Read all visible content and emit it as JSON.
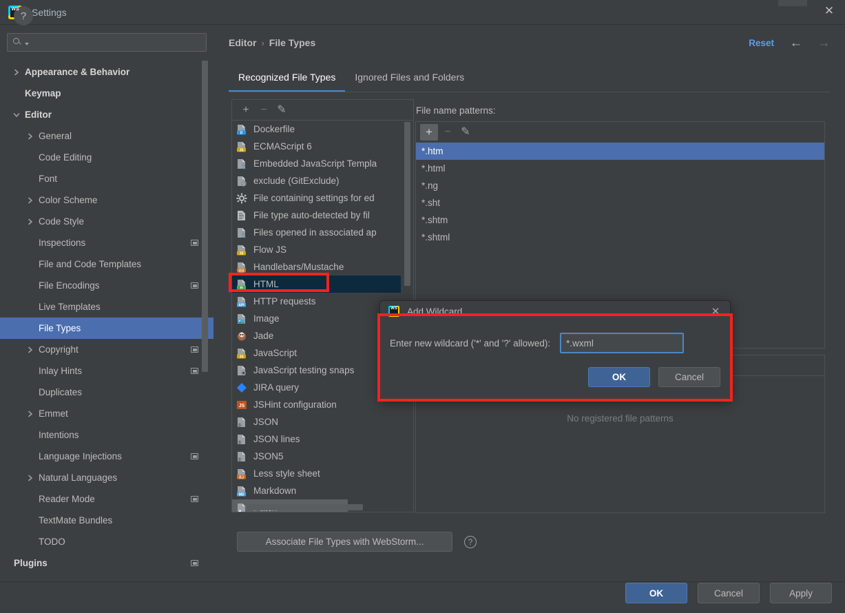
{
  "window": {
    "title": "Settings",
    "logo_text": "WS",
    "close_icon": "✕"
  },
  "sidebar": {
    "search": {
      "value": "",
      "placeholder": ""
    },
    "items": [
      {
        "label": "Appearance & Behavior",
        "arrow": "right",
        "indent": 20,
        "bold": true,
        "badge": false,
        "selected": false
      },
      {
        "label": "Keymap",
        "arrow": "none",
        "indent": 36,
        "bold": true,
        "badge": false,
        "selected": false
      },
      {
        "label": "Editor",
        "arrow": "down",
        "indent": 20,
        "bold": true,
        "badge": false,
        "selected": false
      },
      {
        "label": "General",
        "arrow": "right",
        "indent": 40,
        "bold": false,
        "badge": false,
        "selected": false
      },
      {
        "label": "Code Editing",
        "arrow": "none",
        "indent": 56,
        "bold": false,
        "badge": false,
        "selected": false
      },
      {
        "label": "Font",
        "arrow": "none",
        "indent": 56,
        "bold": false,
        "badge": false,
        "selected": false
      },
      {
        "label": "Color Scheme",
        "arrow": "right",
        "indent": 40,
        "bold": false,
        "badge": false,
        "selected": false
      },
      {
        "label": "Code Style",
        "arrow": "right",
        "indent": 40,
        "bold": false,
        "badge": false,
        "selected": false
      },
      {
        "label": "Inspections",
        "arrow": "none",
        "indent": 56,
        "bold": false,
        "badge": true,
        "selected": false
      },
      {
        "label": "File and Code Templates",
        "arrow": "none",
        "indent": 56,
        "bold": false,
        "badge": false,
        "selected": false
      },
      {
        "label": "File Encodings",
        "arrow": "none",
        "indent": 56,
        "bold": false,
        "badge": true,
        "selected": false
      },
      {
        "label": "Live Templates",
        "arrow": "none",
        "indent": 56,
        "bold": false,
        "badge": false,
        "selected": false
      },
      {
        "label": "File Types",
        "arrow": "none",
        "indent": 56,
        "bold": false,
        "badge": false,
        "selected": true
      },
      {
        "label": "Copyright",
        "arrow": "right",
        "indent": 40,
        "bold": false,
        "badge": true,
        "selected": false
      },
      {
        "label": "Inlay Hints",
        "arrow": "none",
        "indent": 56,
        "bold": false,
        "badge": true,
        "selected": false
      },
      {
        "label": "Duplicates",
        "arrow": "none",
        "indent": 56,
        "bold": false,
        "badge": false,
        "selected": false
      },
      {
        "label": "Emmet",
        "arrow": "right",
        "indent": 40,
        "bold": false,
        "badge": false,
        "selected": false
      },
      {
        "label": "Intentions",
        "arrow": "none",
        "indent": 56,
        "bold": false,
        "badge": false,
        "selected": false
      },
      {
        "label": "Language Injections",
        "arrow": "none",
        "indent": 56,
        "bold": false,
        "badge": true,
        "selected": false
      },
      {
        "label": "Natural Languages",
        "arrow": "right",
        "indent": 40,
        "bold": false,
        "badge": false,
        "selected": false
      },
      {
        "label": "Reader Mode",
        "arrow": "none",
        "indent": 56,
        "bold": false,
        "badge": true,
        "selected": false
      },
      {
        "label": "TextMate Bundles",
        "arrow": "none",
        "indent": 56,
        "bold": false,
        "badge": false,
        "selected": false
      },
      {
        "label": "TODO",
        "arrow": "none",
        "indent": 56,
        "bold": false,
        "badge": false,
        "selected": false
      },
      {
        "label": "Plugins",
        "arrow": "none",
        "indent": 20,
        "bold": true,
        "badge": true,
        "selected": false
      }
    ]
  },
  "header": {
    "breadcrumb": [
      "Editor",
      "File Types"
    ],
    "breadcrumb_separator": "›",
    "reset_label": "Reset",
    "back_icon": "←",
    "forward_icon": "→"
  },
  "tabs": [
    {
      "label": "Recognized File Types",
      "active": true
    },
    {
      "label": "Ignored Files and Folders",
      "active": false
    }
  ],
  "file_types_panel": {
    "toolbar": {
      "add_icon": "+",
      "remove_icon": "−",
      "edit_icon": "✎"
    },
    "items": [
      {
        "label": "Dockerfile",
        "icon": "file-docker-icon",
        "state": "normal"
      },
      {
        "label": "ECMAScript 6",
        "icon": "file-js-icon",
        "state": "normal"
      },
      {
        "label": "Embedded JavaScript Templa",
        "icon": "file-template-icon",
        "state": "normal"
      },
      {
        "label": "exclude (GitExclude)",
        "icon": "file-exclude-icon",
        "state": "normal"
      },
      {
        "label": "File containing settings for ed",
        "icon": "gear-icon",
        "state": "normal"
      },
      {
        "label": "File type auto-detected by fil",
        "icon": "file-text-icon",
        "state": "normal"
      },
      {
        "label": "Files opened in associated ap",
        "icon": "file-assoc-icon",
        "state": "normal"
      },
      {
        "label": "Flow JS",
        "icon": "file-js-icon",
        "state": "normal"
      },
      {
        "label": "Handlebars/Mustache",
        "icon": "file-hbs-icon",
        "state": "normal"
      },
      {
        "label": "HTML",
        "icon": "file-html-icon",
        "state": "selected-inactive"
      },
      {
        "label": "HTTP requests",
        "icon": "file-api-icon",
        "state": "normal"
      },
      {
        "label": "Image",
        "icon": "file-image-icon",
        "state": "normal"
      },
      {
        "label": "Jade",
        "icon": "jade-icon",
        "state": "normal"
      },
      {
        "label": "JavaScript",
        "icon": "file-js-icon",
        "state": "normal"
      },
      {
        "label": "JavaScript testing snaps",
        "icon": "file-snap-icon",
        "state": "normal"
      },
      {
        "label": "JIRA query",
        "icon": "jira-icon",
        "state": "normal"
      },
      {
        "label": "JSHint configuration",
        "icon": "jshint-icon",
        "state": "normal"
      },
      {
        "label": "JSON",
        "icon": "file-json-icon",
        "state": "normal"
      },
      {
        "label": "JSON lines",
        "icon": "file-json-icon",
        "state": "normal"
      },
      {
        "label": "JSON5",
        "icon": "file-json-icon",
        "state": "normal"
      },
      {
        "label": "Less style sheet",
        "icon": "file-less-icon",
        "state": "normal"
      },
      {
        "label": "Markdown",
        "icon": "file-md-icon",
        "state": "normal"
      },
      {
        "label": "Patch",
        "icon": "file-patch-icon",
        "state": "hover"
      }
    ]
  },
  "patterns_panel": {
    "label": "File name patterns:",
    "toolbar": {
      "add_icon": "+",
      "remove_icon": "−",
      "edit_icon": "✎"
    },
    "items": [
      {
        "value": "*.htm",
        "selected": true
      },
      {
        "value": "*.html",
        "selected": false
      },
      {
        "value": "*.ng",
        "selected": false
      },
      {
        "value": "*.sht",
        "selected": false
      },
      {
        "value": "*.shtm",
        "selected": false
      },
      {
        "value": "*.shtml",
        "selected": false
      }
    ]
  },
  "patterns_panel2": {
    "empty_text": "No registered file patterns"
  },
  "footer": {
    "associate_label": "Associate File Types with WebStorm...",
    "help_icon": "?",
    "help_button_icon": "?",
    "ok_label": "OK",
    "cancel_label": "Cancel",
    "apply_label": "Apply"
  },
  "dialog": {
    "title": "Add Wildcard",
    "logo_text": "WS",
    "close_icon": "✕",
    "prompt": "Enter new wildcard ('*' and '?' allowed):",
    "input_value": "*.wxml",
    "input_placeholder": "",
    "ok_label": "OK",
    "cancel_label": "Cancel"
  },
  "annotations": {
    "accent_color": "#f2231f",
    "targets": [
      "html-file-type-row",
      "add-wildcard-dialog"
    ]
  },
  "colors": {
    "window_bg": "#3c3f41",
    "selection_blue": "#4b6eaf",
    "selection_inactive": "#0d293e",
    "link_blue": "#589df6",
    "tab_underline": "#4a88c7",
    "text": "#bbbbbb",
    "annotation_red": "#f2231f"
  }
}
